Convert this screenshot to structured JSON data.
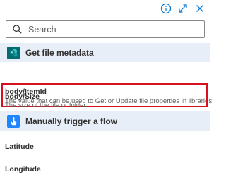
{
  "search": {
    "placeholder": "Search"
  },
  "sections": [
    {
      "title": "Get file metadata",
      "icon": "sharepoint-icon",
      "color": "#036c70",
      "items": [
        {
          "label": "body/ItemId",
          "description": "The value that can be used to Get or Update file properties in libraries.",
          "highlighted": true
        },
        {
          "label": "body/Size",
          "description": "The size of the file or folder."
        }
      ]
    },
    {
      "title": "Manually trigger a flow",
      "icon": "manual-trigger-icon",
      "color": "#1f85ff",
      "items": [
        {
          "label": "Latitude"
        },
        {
          "label": "Longitude"
        }
      ]
    }
  ],
  "colors": {
    "highlight": "#d6111f",
    "section_bg": "#e8eef7",
    "accent": "#0078d4"
  }
}
